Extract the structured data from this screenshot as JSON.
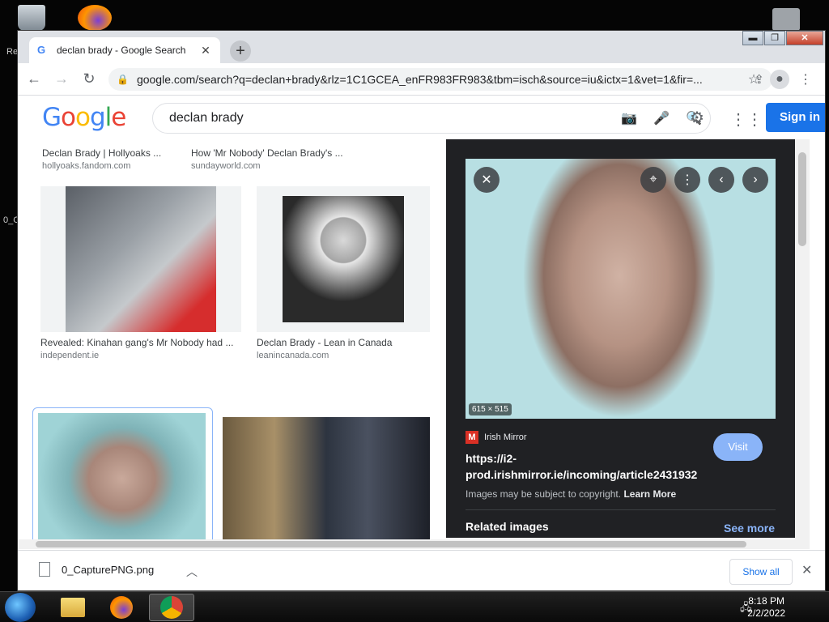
{
  "desktop": {
    "icon_labels": [
      "Re",
      "0_C"
    ]
  },
  "tab": {
    "title": "declan brady - Google Search",
    "favicon": "G"
  },
  "window_controls": {
    "minimize": "▬",
    "maximize": "❐",
    "close": "✕"
  },
  "address_bar": {
    "url": "google.com/search?q=declan+brady&rlz=1C1GCEA_enFR983FR983&tbm=isch&source=iu&ictx=1&vet=1&fir=..."
  },
  "google": {
    "logo": [
      "G",
      "o",
      "o",
      "g",
      "l",
      "e"
    ],
    "logo_colors": [
      "#4285F4",
      "#EA4335",
      "#FBBC05",
      "#4285F4",
      "#34A853",
      "#EA4335"
    ],
    "query": "declan brady",
    "signin": "Sign in"
  },
  "results": [
    {
      "caption": "Declan Brady | Hollyoaks ...",
      "source": "hollyoaks.fandom.com"
    },
    {
      "caption": "How 'Mr Nobody' Declan Brady's ...",
      "source": "sundayworld.com"
    },
    {
      "caption": "Revealed: Kinahan gang's Mr Nobody had ...",
      "source": "independent.ie"
    },
    {
      "caption": "Declan Brady - Lean in Canada",
      "source": "leanincanada.com"
    }
  ],
  "preview": {
    "dimensions": "615 × 515",
    "source_name": "Irish Mirror",
    "source_logo": "M",
    "link": "https://i2-\nprod.irishmirror.ie/incoming/article2431932",
    "visit": "Visit",
    "copyright_text": "Images may be subject to copyright.",
    "learn_more": "Learn More",
    "related": "Related images",
    "see_more": "See more"
  },
  "download": {
    "filename": "0_CapturePNG.png",
    "show_all": "Show all"
  },
  "taskbar": {
    "time": "8:18 PM",
    "date": "2/2/2022"
  }
}
